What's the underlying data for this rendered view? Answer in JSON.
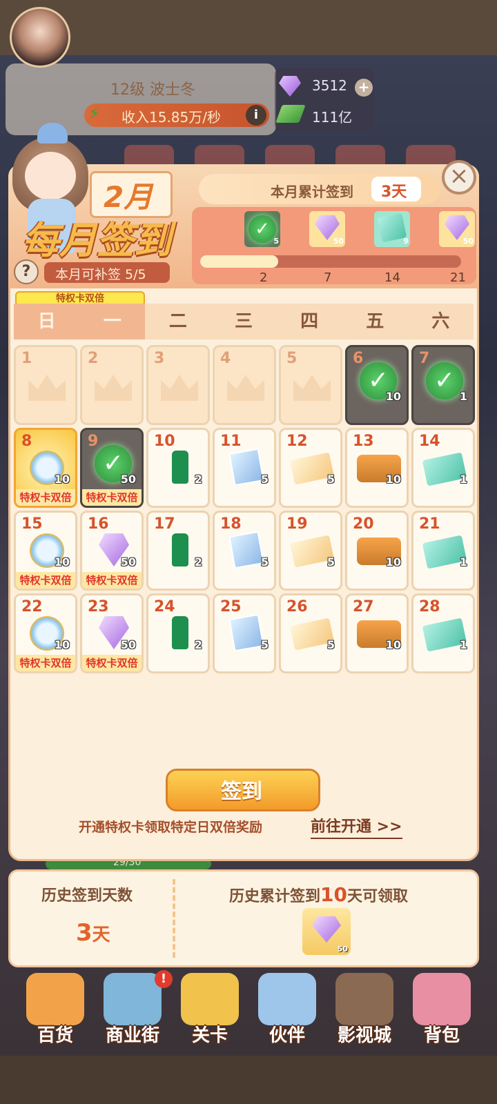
{
  "player": {
    "level_name": "12级   波士冬",
    "income": "收入15.85万/秒",
    "gems": "3512",
    "cash": "111亿"
  },
  "modal": {
    "month": "2月",
    "title": "每月签到",
    "cumulative_label": "本月累计签到",
    "cumulative_value": "3天",
    "makeup_label": "本月可补签 ",
    "makeup_count": "5/5",
    "progress": 0.3,
    "milestones": [
      {
        "day": "2",
        "reward_icon": "check-icon",
        "qty": "5",
        "claimed": true
      },
      {
        "day": "7",
        "reward_icon": "gem-icon",
        "qty": "50",
        "claimed": false
      },
      {
        "day": "14",
        "reward_icon": "ticket-icon",
        "qty": "9",
        "claimed": false
      },
      {
        "day": "21",
        "reward_icon": "gem-icon",
        "qty": "50",
        "claimed": false
      }
    ],
    "privilege_tag": "特权卡双倍",
    "weekdays": [
      "日",
      "一",
      "二",
      "三",
      "四",
      "五",
      "六"
    ],
    "double_label": "特权卡双倍",
    "sign_button": "签到",
    "promo_text": "开通特权卡领取特定日双倍奖励",
    "promo_link": "前往开通 >>"
  },
  "calendar": [
    {
      "day": "1",
      "state": "past",
      "icon": "crown-icon"
    },
    {
      "day": "2",
      "state": "past",
      "icon": "crown-icon"
    },
    {
      "day": "3",
      "state": "past",
      "icon": "crown-icon"
    },
    {
      "day": "4",
      "state": "past",
      "icon": "crown-icon"
    },
    {
      "day": "5",
      "state": "past",
      "icon": "crown-icon"
    },
    {
      "day": "6",
      "state": "done",
      "icon": "check-icon",
      "qty": "10"
    },
    {
      "day": "7",
      "state": "done",
      "icon": "check-icon",
      "qty": "1"
    },
    {
      "day": "8",
      "state": "today",
      "icon": "mirror-icon",
      "qty": "10",
      "double": true
    },
    {
      "day": "9",
      "state": "done",
      "icon": "check-icon",
      "qty": "50",
      "double": true
    },
    {
      "day": "10",
      "state": "future",
      "icon": "bottle-icon",
      "qty": "2"
    },
    {
      "day": "11",
      "state": "future",
      "icon": "mystery-card-icon",
      "qty": "5"
    },
    {
      "day": "12",
      "state": "future",
      "icon": "ticket-icon",
      "qty": "5"
    },
    {
      "day": "13",
      "state": "future",
      "icon": "food-box-icon",
      "qty": "10"
    },
    {
      "day": "14",
      "state": "future",
      "icon": "voucher-icon",
      "qty": "1"
    },
    {
      "day": "15",
      "state": "future",
      "icon": "mirror-icon",
      "qty": "10",
      "double": true
    },
    {
      "day": "16",
      "state": "future",
      "icon": "gem-icon",
      "qty": "50",
      "double": true
    },
    {
      "day": "17",
      "state": "future",
      "icon": "bottle-icon",
      "qty": "2"
    },
    {
      "day": "18",
      "state": "future",
      "icon": "mystery-card-icon",
      "qty": "5"
    },
    {
      "day": "19",
      "state": "future",
      "icon": "ticket-icon",
      "qty": "5"
    },
    {
      "day": "20",
      "state": "future",
      "icon": "food-box-icon",
      "qty": "10"
    },
    {
      "day": "21",
      "state": "future",
      "icon": "voucher-icon",
      "qty": "1"
    },
    {
      "day": "22",
      "state": "future",
      "icon": "mirror-icon",
      "qty": "10",
      "double": true
    },
    {
      "day": "23",
      "state": "future",
      "icon": "gem-icon",
      "qty": "50",
      "double": true
    },
    {
      "day": "24",
      "state": "future",
      "icon": "bottle-icon",
      "qty": "2"
    },
    {
      "day": "25",
      "state": "future",
      "icon": "mystery-card-icon",
      "qty": "5"
    },
    {
      "day": "26",
      "state": "future",
      "icon": "ticket-icon",
      "qty": "5"
    },
    {
      "day": "27",
      "state": "future",
      "icon": "food-box-icon",
      "qty": "10"
    },
    {
      "day": "28",
      "state": "future",
      "icon": "voucher-icon",
      "qty": "1"
    }
  ],
  "behind_progress": "29/30",
  "history": {
    "days_label": "历史签到天数",
    "days_value": "3",
    "days_unit": "天",
    "reward_label_prefix": "历史累计签到",
    "reward_label_highlight": "10",
    "reward_label_suffix": "天可领取",
    "reward_qty": "50"
  },
  "nav": [
    {
      "label": "百货",
      "alert": false
    },
    {
      "label": "商业街",
      "alert": true
    },
    {
      "label": "关卡",
      "alert": false
    },
    {
      "label": "伙伴",
      "alert": false
    },
    {
      "label": "影视城",
      "alert": false
    },
    {
      "label": "背包",
      "alert": false
    }
  ],
  "colors": {
    "accent": "#e5792e",
    "panel": "#fcefdc",
    "done_cell": "#6c645f",
    "today_cell": "#f9c640",
    "double_text": "#e0352b"
  }
}
